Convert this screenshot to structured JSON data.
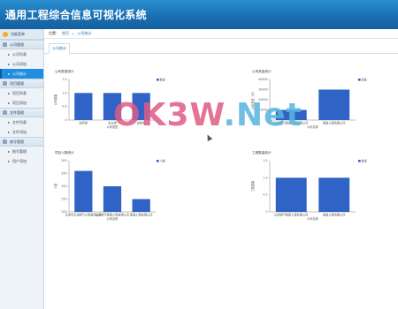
{
  "app": {
    "title": "通用工程综合信息可视化系统"
  },
  "sidebar": {
    "home_label": "功能菜单",
    "groups": [
      {
        "label": "公司管理",
        "items": [
          {
            "label": "公司列表"
          },
          {
            "label": "公司添加"
          },
          {
            "label": "公司统计"
          }
        ]
      },
      {
        "label": "项目管理",
        "items": [
          {
            "label": "项目列表"
          },
          {
            "label": "项目添加"
          }
        ]
      },
      {
        "label": "文件管理",
        "items": [
          {
            "label": "文件列表"
          },
          {
            "label": "文件添加"
          }
        ]
      },
      {
        "label": "账号管理",
        "items": [
          {
            "label": "账号管理"
          },
          {
            "label": "用户添加"
          }
        ]
      }
    ]
  },
  "breadcrumb": {
    "label": "位置：",
    "home": "首页",
    "sep": ">",
    "current": "公司统计"
  },
  "tabs": [
    {
      "label": "公司统计"
    }
  ],
  "colors": {
    "bar": "#2f63c6",
    "header": "#1a6fb3",
    "active": "#1e8ee0"
  },
  "watermark": {
    "part1": "OK3W",
    "part2": ".Net"
  },
  "chart_data": [
    {
      "type": "bar",
      "title": "公司类型统计",
      "categories": [
        "政府类",
        "企业类",
        "其他类"
      ],
      "values": [
        1,
        1,
        1
      ],
      "ylim": [
        0,
        1.5
      ],
      "yticks": [
        "1.5",
        "1.0",
        "0.5",
        "0"
      ],
      "ylabel": "公司数量",
      "xlabel": "公司类型",
      "legend": "数量"
    },
    {
      "type": "bar",
      "title": "公司资金统计",
      "categories": [
        "山西燃气集团工程有限公司",
        "奥鑫工程有限公司"
      ],
      "values": [
        10000,
        30000
      ],
      "ylim": [
        0,
        40000
      ],
      "yticks": [
        "40000",
        "30000",
        "20000",
        "10000",
        "0"
      ],
      "ylabel": "公司资金（元）",
      "xlabel": "公司名称",
      "legend": "资金"
    },
    {
      "type": "bar",
      "title": "项目人数统计",
      "categories": [
        "天津市天津燃气工程有限公司",
        "山西燃气集团工程有限公司",
        "奥鑫工程有限公司"
      ],
      "values": [
        260,
        200,
        150
      ],
      "ylim": [
        100,
        300
      ],
      "yticks": [
        "300",
        "250",
        "200",
        "150",
        "100"
      ],
      "ylabel": "人数",
      "xlabel": "公司名称",
      "legend": "人数"
    },
    {
      "type": "bar",
      "title": "工程数量统计",
      "categories": [
        "山西燃气集团工程有限公司",
        "奥鑫工程有限公司"
      ],
      "values": [
        1,
        1
      ],
      "ylim": [
        0,
        1.5
      ],
      "yticks": [
        "1.5",
        "1.0",
        "0.5",
        "0"
      ],
      "ylabel": "工程数量",
      "xlabel": "公司名称",
      "legend": "数量"
    }
  ]
}
